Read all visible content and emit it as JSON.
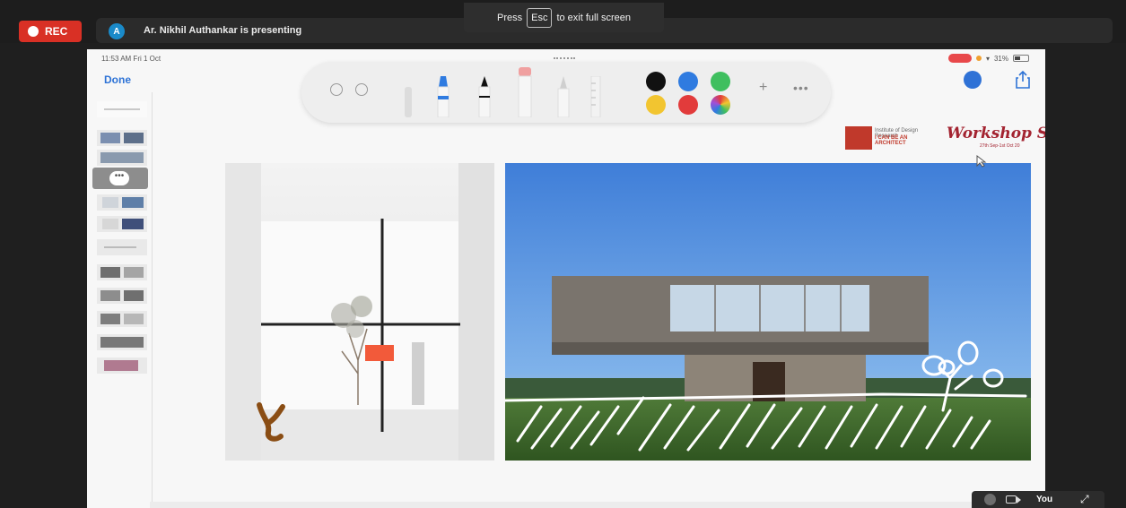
{
  "meeting": {
    "rec_label": "REC",
    "presenter_avatar_letter": "A",
    "presenter_status": "Ar. Nikhil Authankar is presenting",
    "fullscreen_toast": {
      "before": "Press",
      "key": "Esc",
      "after": "to exit full screen"
    },
    "self_view_label": "You"
  },
  "ipad": {
    "status_time": "11:53 AM  Fri 1 Oct",
    "battery": "31%",
    "done_label": "Done",
    "toolbar_colors": [
      "#111111",
      "#2f7be0",
      "#3fbf5f",
      "#f2c530",
      "#e23b3b",
      "rainbow"
    ]
  },
  "slide": {
    "logo_line1": "Institute of Design Research",
    "logo_line2": "I CAN BE AN ARCHITECT",
    "title": "Workshop S",
    "subtitle": "27th Sep-1st Oct 20"
  },
  "colors": {
    "rec": "#d93025",
    "accent": "#2e73d6",
    "brand": "#a32330"
  }
}
